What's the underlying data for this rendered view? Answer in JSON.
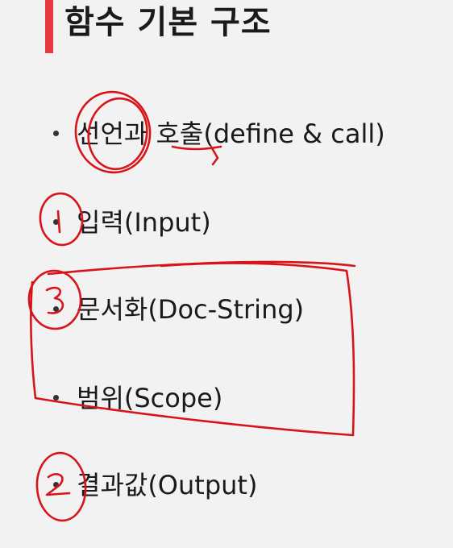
{
  "slide": {
    "title": "함수 기본 구조",
    "accent_color": "#e8393f",
    "annotation_color": "#d8141b",
    "items": [
      {
        "label": "선언과 호출(define & call)"
      },
      {
        "label": "입력(Input)"
      },
      {
        "label": "문서화(Doc-String)"
      },
      {
        "label": "범위(Scope)"
      },
      {
        "label": "결과값(Output)"
      }
    ],
    "annotations": {
      "mark_input": "1",
      "mark_docstring": "3",
      "mark_output": "2"
    }
  }
}
